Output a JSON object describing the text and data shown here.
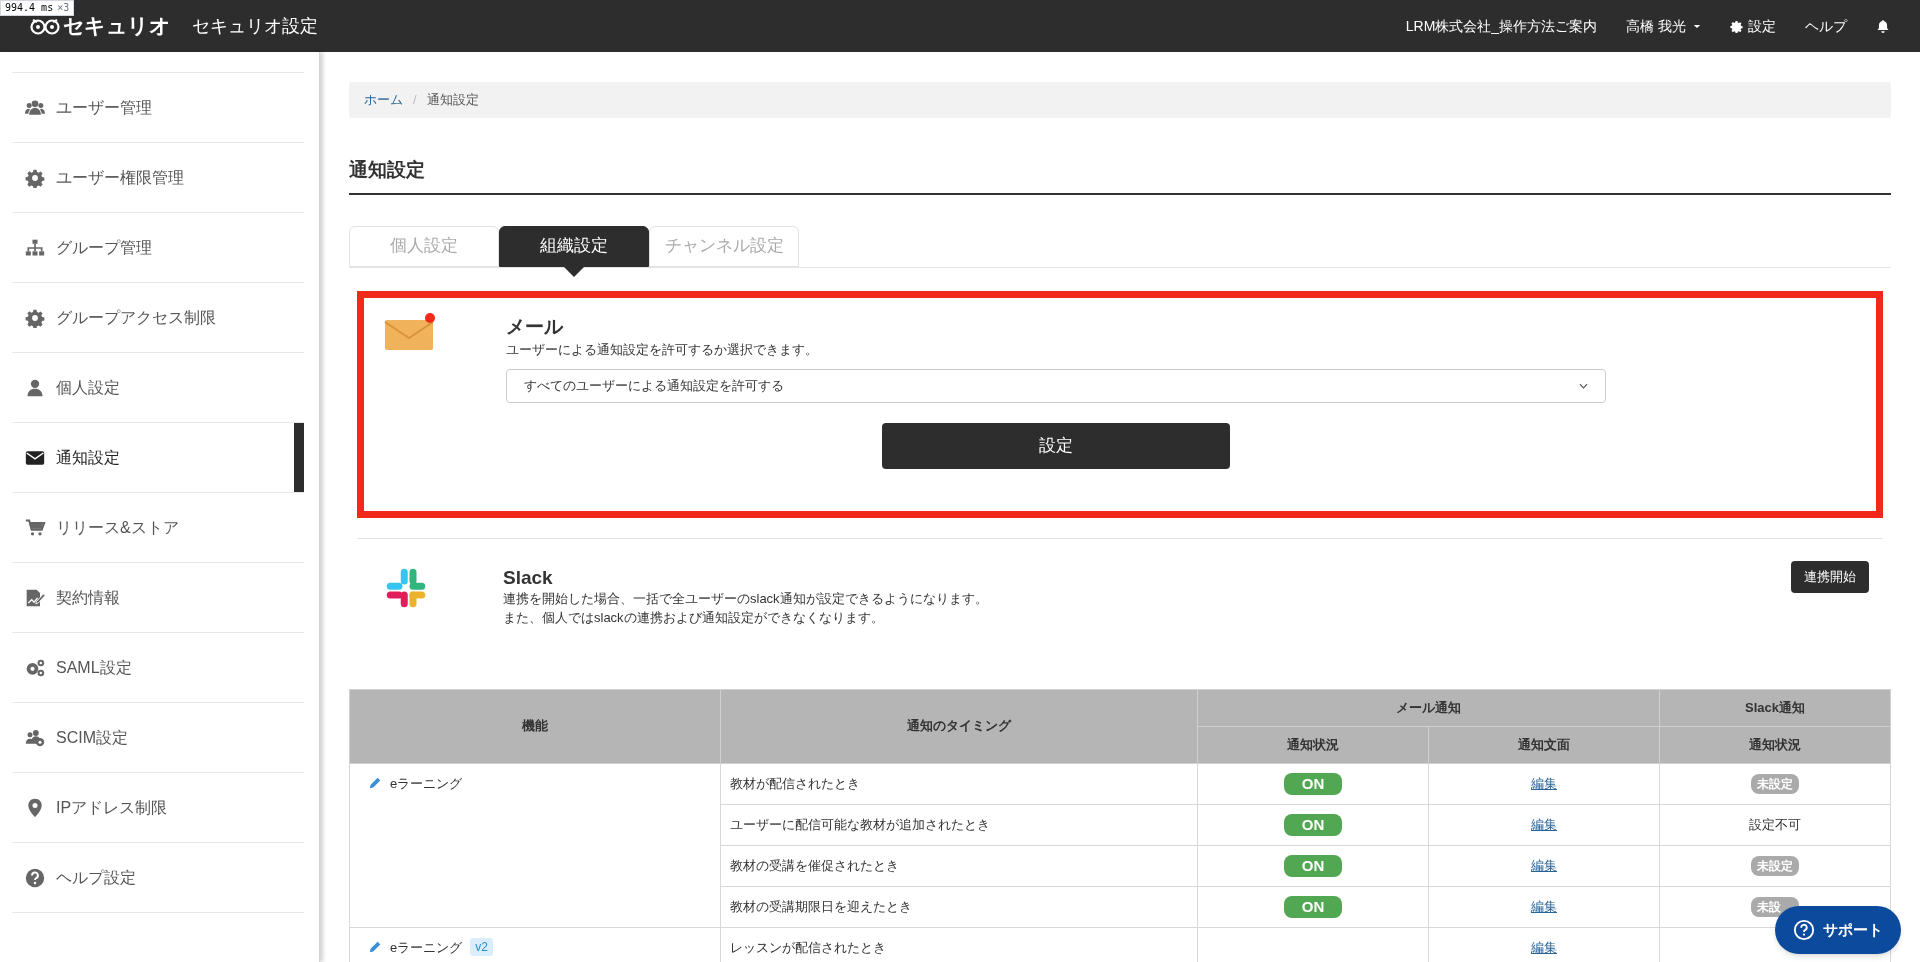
{
  "perf_badge": {
    "time": "994.4 ms",
    "count": "×3"
  },
  "header": {
    "logo": "セキュリオ",
    "title": "セキュリオ設定",
    "links": [
      {
        "kind": "text",
        "label": "LRM株式会社_操作方法ご案内"
      },
      {
        "kind": "user",
        "label": "高橋 我光"
      },
      {
        "kind": "settings",
        "label": "設定"
      },
      {
        "kind": "text",
        "label": "ヘルプ"
      },
      {
        "kind": "bell"
      }
    ]
  },
  "sidebar": {
    "items": [
      {
        "label": "ユーザー管理",
        "selected": false
      },
      {
        "label": "ユーザー権限管理",
        "selected": false
      },
      {
        "label": "グループ管理",
        "selected": false
      },
      {
        "label": "グループアクセス制限",
        "selected": false
      },
      {
        "label": "個人設定",
        "selected": false
      },
      {
        "label": "通知設定",
        "selected": true
      },
      {
        "label": "リリース&ストア",
        "selected": false
      },
      {
        "label": "契約情報",
        "selected": false
      },
      {
        "label": "SAML設定",
        "selected": false
      },
      {
        "label": "SCIM設定",
        "selected": false
      },
      {
        "label": "IPアドレス制限",
        "selected": false
      },
      {
        "label": "ヘルプ設定",
        "selected": false
      }
    ]
  },
  "breadcrumb": {
    "separator": "/",
    "items": [
      {
        "label": "ホーム",
        "link": true
      },
      {
        "label": "通知設定",
        "link": false
      }
    ]
  },
  "page_title": "通知設定",
  "tabs": [
    {
      "label": "個人設定",
      "selected": false
    },
    {
      "label": "組織設定",
      "selected": true
    },
    {
      "label": "チャンネル設定",
      "selected": false
    }
  ],
  "mail": {
    "title": "メール",
    "description": "ユーザーによる通知設定を許可するか選択できます。",
    "select_value": "すべてのユーザーによる通知設定を許可する",
    "button": "設定"
  },
  "slack": {
    "title": "Slack",
    "description_lines": [
      "連携を開始した場合、一括で全ユーザーのslack通知が設定できるようになります。",
      "また、個人ではslackの連携および通知設定ができなくなります。"
    ],
    "button": "連携開始"
  },
  "table": {
    "columns": {
      "feature": "機能",
      "timing": "通知のタイミング",
      "mail_group": "メール通知",
      "mail_status": "通知状況",
      "mail_text": "通知文面",
      "slack_group": "Slack通知",
      "slack_status": "通知状況"
    },
    "groups": [
      {
        "feature": "eラーニング",
        "rows": [
          {
            "timing": "教材が配信されたとき",
            "mail_status": {
              "label": "ON",
              "on": true
            },
            "mail_text": "編集",
            "slack_status": {
              "kind": "badge",
              "label": "未設定"
            }
          },
          {
            "timing": "ユーザーに配信可能な教材が追加されたとき",
            "mail_status": {
              "label": "ON",
              "on": true
            },
            "mail_text": "編集",
            "slack_status": {
              "kind": "text",
              "label": "設定不可"
            }
          },
          {
            "timing": "教材の受講を催促されたとき",
            "mail_status": {
              "label": "ON",
              "on": true
            },
            "mail_text": "編集",
            "slack_status": {
              "kind": "badge",
              "label": "未設定"
            }
          },
          {
            "timing": "教材の受講期限日を迎えたとき",
            "mail_status": {
              "label": "ON",
              "on": true
            },
            "mail_text": "編集",
            "slack_status": {
              "kind": "badge",
              "label": "未設"
            }
          }
        ]
      },
      {
        "feature": "eラーニング",
        "tag": "v2",
        "rows": [
          {
            "timing": "レッスンが配信されたとき",
            "mail_text": "編集"
          }
        ]
      }
    ]
  },
  "support_button": "サポート"
}
